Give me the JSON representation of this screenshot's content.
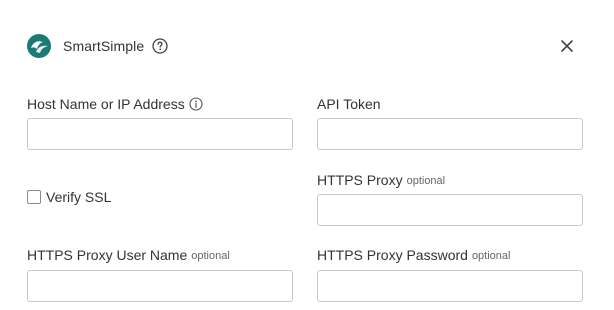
{
  "dialog": {
    "title": "SmartSimple",
    "icons": {
      "logo": "smartsimple-logo",
      "help": "help-circle-icon",
      "close": "close-icon",
      "info": "info-icon"
    },
    "colors": {
      "brand": "#1a7b74",
      "text": "#333333",
      "muted": "#666666",
      "border": "#c9c9c9"
    }
  },
  "form": {
    "host": {
      "label": "Host Name or IP Address",
      "value": "",
      "placeholder": ""
    },
    "api_token": {
      "label": "API Token",
      "value": "",
      "placeholder": ""
    },
    "verify_ssl": {
      "label": "Verify SSL",
      "checked": false
    },
    "https_proxy": {
      "label": "HTTPS Proxy",
      "optional": "optional",
      "value": "",
      "placeholder": ""
    },
    "proxy_user": {
      "label": "HTTPS Proxy User Name",
      "optional": "optional",
      "value": "",
      "placeholder": ""
    },
    "proxy_password": {
      "label": "HTTPS Proxy Password",
      "optional": "optional",
      "value": "",
      "placeholder": ""
    }
  }
}
